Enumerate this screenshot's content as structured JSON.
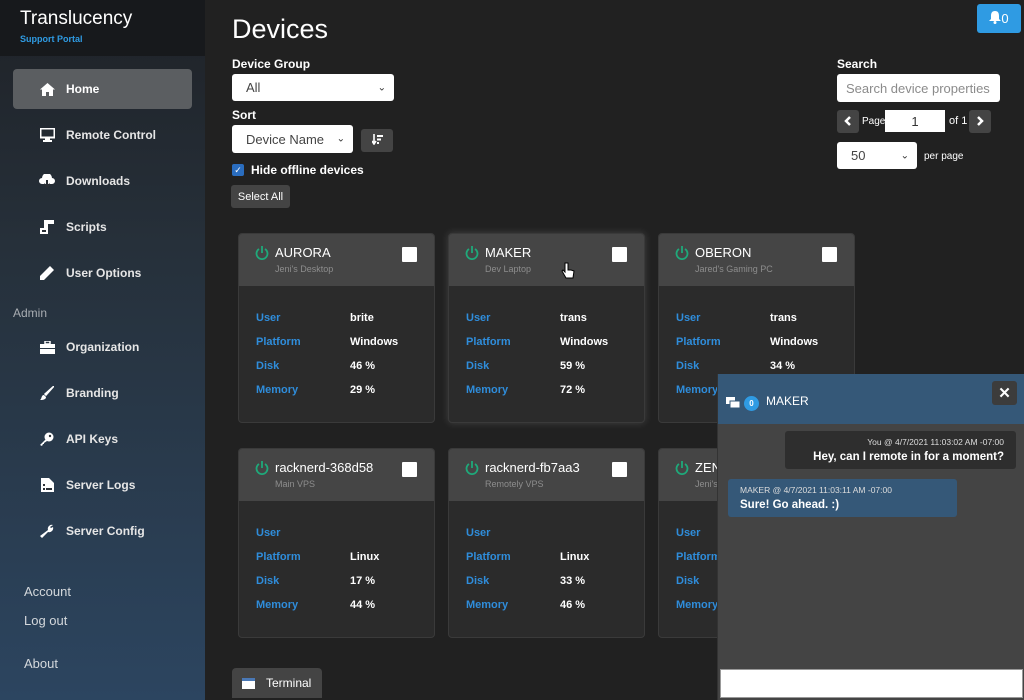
{
  "app": {
    "title": "Translucency",
    "subtitle": "Support Portal"
  },
  "sidebar": {
    "items": [
      {
        "label": "Home",
        "icon": "home-icon",
        "active": true
      },
      {
        "label": "Remote Control",
        "icon": "monitor-icon"
      },
      {
        "label": "Downloads",
        "icon": "cloud-download-icon"
      },
      {
        "label": "Scripts",
        "icon": "scroll-icon"
      },
      {
        "label": "User Options",
        "icon": "pencil-icon"
      }
    ],
    "admin_label": "Admin",
    "admin_items": [
      {
        "label": "Organization",
        "icon": "briefcase-icon"
      },
      {
        "label": "Branding",
        "icon": "brush-icon"
      },
      {
        "label": "API Keys",
        "icon": "key-icon"
      },
      {
        "label": "Server Logs",
        "icon": "log-file-icon"
      },
      {
        "label": "Server Config",
        "icon": "wrench-icon"
      }
    ],
    "bottom_links": [
      "Account",
      "Log out",
      "About"
    ]
  },
  "header": {
    "page_title": "Devices",
    "notifications": {
      "icon": "bell-icon",
      "count": "0"
    }
  },
  "filters": {
    "device_group_label": "Device Group",
    "device_group_value": "All",
    "sort_label": "Sort",
    "sort_value": "Device Name",
    "sort_direction_icon": "sort-descending-icon",
    "hide_offline_label": "Hide offline devices",
    "hide_offline_checked": true,
    "select_all_label": "Select All"
  },
  "search": {
    "label": "Search",
    "placeholder": "Search device properties",
    "page_label": "Page",
    "page_value": "1",
    "of_label": "of 1",
    "per_page_value": "50",
    "per_page_label": "per page"
  },
  "field_labels": {
    "user": "User",
    "platform": "Platform",
    "disk": "Disk",
    "memory": "Memory"
  },
  "devices": [
    {
      "name": "AURORA",
      "alias": "Jeni's Desktop",
      "user": "brite",
      "platform": "Windows",
      "disk": "46 %",
      "memory": "29 %",
      "online": true
    },
    {
      "name": "MAKER",
      "alias": "Dev Laptop",
      "user": "trans",
      "platform": "Windows",
      "disk": "59 %",
      "memory": "72 %",
      "online": true
    },
    {
      "name": "OBERON",
      "alias": "Jared's Gaming PC",
      "user": "trans",
      "platform": "Windows",
      "disk": "34 %",
      "memory": "",
      "online": true
    },
    {
      "name": "racknerd-368d58",
      "alias": "Main VPS",
      "user": "",
      "platform": "Linux",
      "disk": "17 %",
      "memory": "44 %",
      "online": true
    },
    {
      "name": "racknerd-fb7aa3",
      "alias": "Remotely VPS",
      "user": "",
      "platform": "Linux",
      "disk": "33 %",
      "memory": "46 %",
      "online": true
    },
    {
      "name": "ZEN",
      "alias": "Jeni's",
      "user": "",
      "platform": "",
      "disk": "",
      "memory": "",
      "online": true
    }
  ],
  "terminal": {
    "label": "Terminal"
  },
  "chat": {
    "device": "MAKER",
    "unread": "0",
    "messages": [
      {
        "sender": "You",
        "time": "4/7/2021 11:03:02 AM -07:00",
        "meta": "You  @  4/7/2021 11:03:02 AM -07:00",
        "text": "Hey, can I remote in for a moment?",
        "direction": "outgoing"
      },
      {
        "sender": "MAKER",
        "time": "4/7/2021 11:03:11 AM -07:00",
        "meta": "MAKER  @  4/7/2021 11:03:11 AM -07:00",
        "text": "Sure! Go ahead. :)",
        "direction": "incoming"
      }
    ]
  },
  "colors": {
    "accent": "#2f9be3",
    "online": "#1fa97a",
    "field_label": "#2f8ddb",
    "chat_header": "#355878"
  }
}
